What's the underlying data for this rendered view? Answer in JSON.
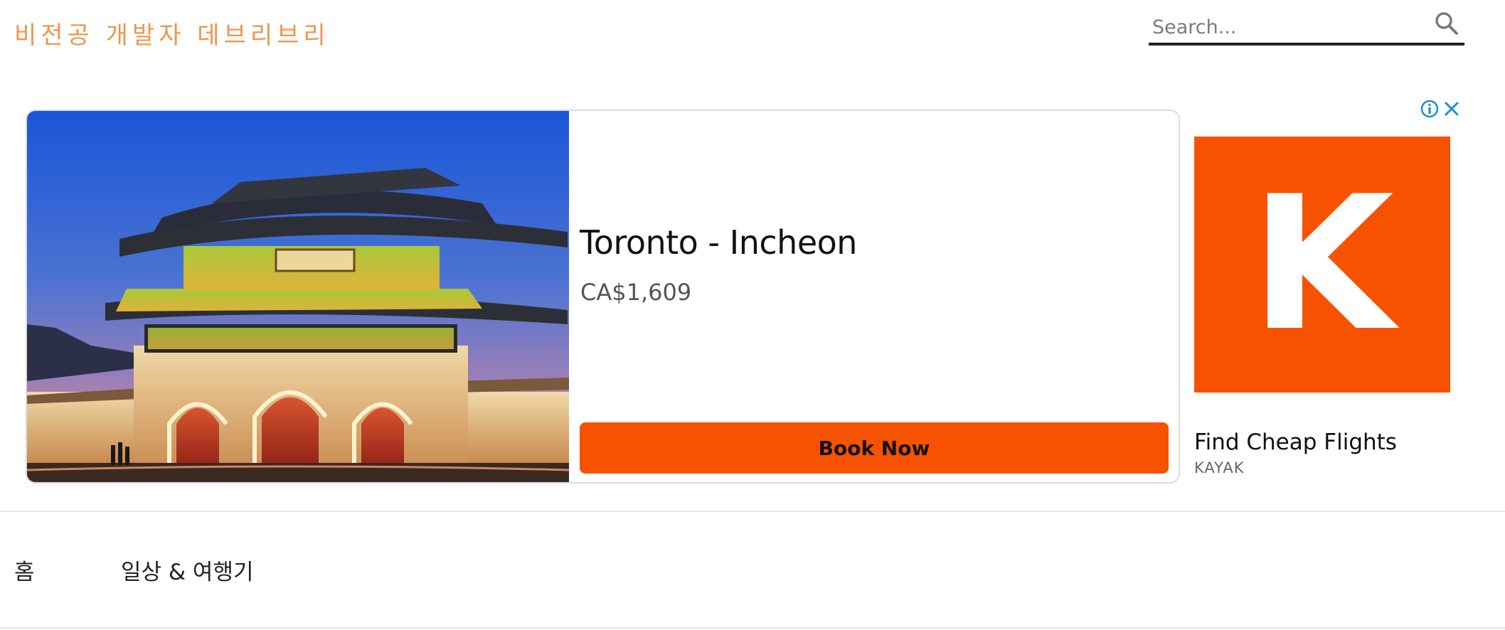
{
  "site": {
    "title": "비전공 개발자 데브리브리"
  },
  "search": {
    "placeholder": "Search...",
    "icon": "search-icon"
  },
  "ad": {
    "info_icon": "info-icon",
    "close_icon": "close-icon",
    "image_subject": "gate-palace-night-photo",
    "headline": "Toronto - Incheon",
    "price": "CA$1,609",
    "cta_label": "Book Now",
    "accent_color": "#f75200",
    "brand": {
      "logo_letter": "K",
      "tagline": "Find Cheap Flights",
      "name": "KAYAK"
    }
  },
  "nav": {
    "items": [
      {
        "label": "홈"
      },
      {
        "label": "일상 & 여행기"
      }
    ]
  },
  "colors": {
    "title_color": "#f2944b",
    "cta_color": "#f75200",
    "info_icon_color": "#1a8fd6"
  }
}
